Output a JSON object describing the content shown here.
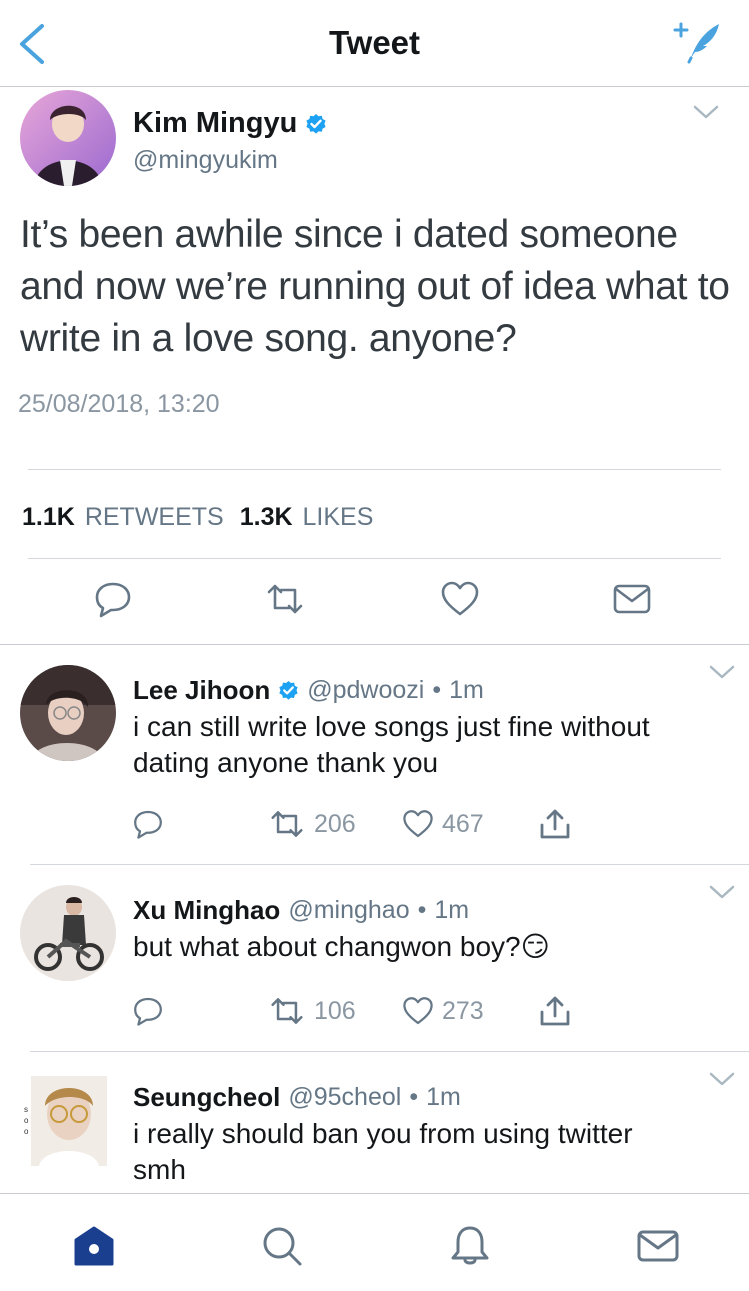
{
  "header": {
    "title": "Tweet",
    "back_icon": "chevron-left-icon",
    "compose_icon": "compose-tweet-icon",
    "accent": "#4aa3df"
  },
  "main_tweet": {
    "name": "Kim Mingyu",
    "verified": true,
    "handle": "@mingyukim",
    "text": "It’s been awhile since i dated someone and now we’re running out of idea what to write in a love song. anyone?",
    "timestamp": "25/08/2018, 13:20",
    "retweets_count": "1.1K",
    "retweets_label": "RETWEETS",
    "likes_count": "1.3K",
    "likes_label": "LIKES",
    "actions": [
      "reply-icon",
      "retweet-icon",
      "like-icon",
      "dm-icon"
    ]
  },
  "replies": [
    {
      "name": "Lee Jihoon",
      "verified": true,
      "handle": "@pdwoozi",
      "time": "1m",
      "text": "i can still write love songs just fine without dating anyone thank you",
      "retweets": "206",
      "likes": "467"
    },
    {
      "name": "Xu Minghao",
      "verified": false,
      "handle": "@minghao",
      "time": "1m",
      "text": "but what about changwon boy?",
      "emoji": "😏",
      "retweets": "106",
      "likes": "273"
    },
    {
      "name": "Seungcheol",
      "verified": false,
      "handle": "@95cheol",
      "time": "1m",
      "text": "i really should ban you from using twitter smh"
    }
  ],
  "separator": "•",
  "side_marks": [
    "s",
    "o",
    "o"
  ],
  "tabbar": {
    "items": [
      "home-icon",
      "search-icon",
      "notifications-icon",
      "messages-icon"
    ],
    "active": "home-icon",
    "active_color": "#1b3f8f"
  },
  "colors": {
    "verified": "#1da1f2",
    "muted": "#657786",
    "icon_gray": "#657786"
  }
}
